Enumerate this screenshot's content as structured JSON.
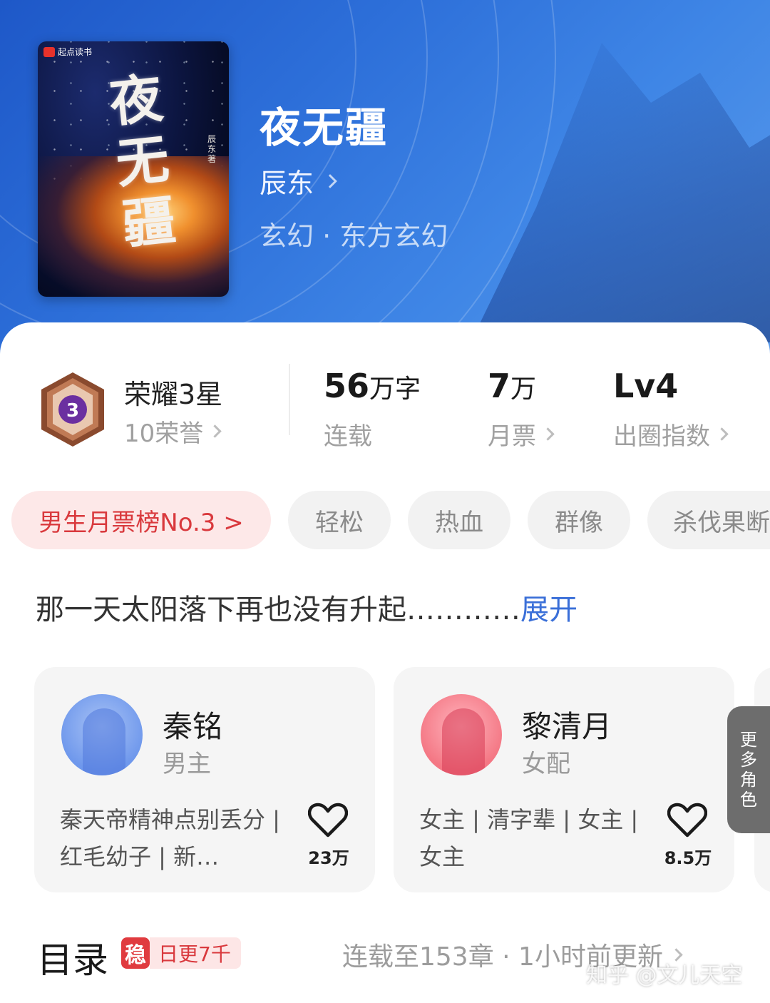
{
  "book": {
    "title": "夜无疆",
    "author": "辰东",
    "genre": "玄幻 · 东方玄幻",
    "cover": {
      "brand": "起点读书",
      "calligraphy": "夜无疆",
      "author_mark": "辰东著"
    }
  },
  "stats": {
    "honor": {
      "title": "荣耀3星",
      "sub": "10荣誉",
      "level": "3"
    },
    "words": {
      "number": "56",
      "unit": "万字",
      "label": "连载"
    },
    "votes": {
      "number": "7",
      "unit": "万",
      "label": "月票"
    },
    "index": {
      "value": "Lv4",
      "label": "出圈指数"
    }
  },
  "tags": {
    "rank": "男生月票榜No.3 >",
    "items": [
      "轻松",
      "热血",
      "群像",
      "杀伐果断"
    ]
  },
  "synopsis": {
    "text": "那一天太阳落下再也没有升起…………",
    "expand": "展开"
  },
  "roles": [
    {
      "name": "秦铭",
      "type": "男主",
      "desc": "秦天帝精神点别丢分 | 红毛幼子 | 新…",
      "likes": "23万"
    },
    {
      "name": "黎清月",
      "type": "女配",
      "desc": "女主 | 清字辈 | 女主 | 女主",
      "likes": "8.5万"
    }
  ],
  "more_roles": "更多角色",
  "catalog": {
    "title": "目录",
    "stable_badge": "稳",
    "daily": "日更7千",
    "status": "连载至153章 · 1小时前更新"
  },
  "watermark": "知乎 @文儿天空",
  "colors": {
    "header_blue": "#2d6fd9",
    "rank_red": "#d9393d",
    "expand_blue": "#3a6fd8",
    "badge_purple": "#6b2fa0"
  }
}
